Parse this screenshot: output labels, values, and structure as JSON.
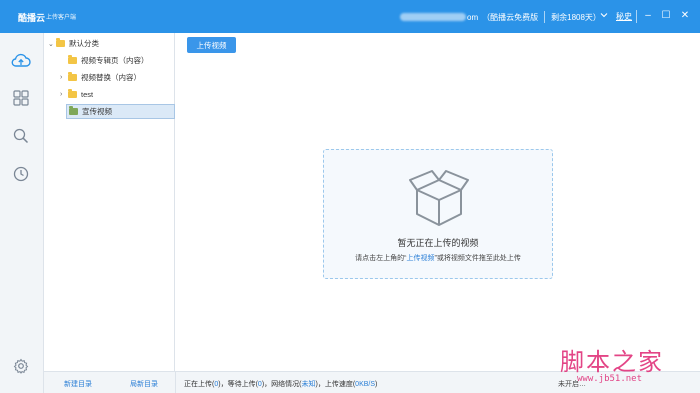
{
  "titlebar": {
    "logo": "酷播云",
    "subtitle": "上传客户端",
    "account_suffix": "om",
    "plan": "（酷播云免费版",
    "remaining": "剩余1808天）",
    "dropdown_icon": "chevron-down-icon",
    "tricks": "秘史",
    "minimize": "–",
    "maximize": "☐",
    "close": "✕"
  },
  "iconnav": {
    "items": [
      "cloud-upload-icon",
      "grid-icon",
      "search-icon",
      "clock-icon",
      "settings-icon"
    ]
  },
  "tree": {
    "root": "默认分类",
    "items": [
      {
        "label": "视频专辑页（内容）"
      },
      {
        "label": "视频替换（内容）"
      },
      {
        "label": "test"
      },
      {
        "label": "宣传视频"
      }
    ]
  },
  "toolbar": {
    "upload_label": "上传视频"
  },
  "dropzone": {
    "title": "暂无正在上传的视频",
    "hint_before": "请点击左上角的“",
    "hint_link": "上传视频",
    "hint_after": "”或将视频文件拖至此处上传"
  },
  "bottom": {
    "new_dir": "新建目录",
    "rename_dir": "局新目录",
    "status_uploading": "正在上传(",
    "uploading_count": "0",
    "status_waiting": ")，等待上传(",
    "waiting_count": "0",
    "status_network": ")，网络情况(",
    "network_value": "未知",
    "status_speed": ")，上传速度(",
    "speed_value": "0KB/S",
    "status_end": ")",
    "right_text": "未开启…"
  },
  "watermark": {
    "main": "脚本之家",
    "sub": "www.jb51.net"
  },
  "colors": {
    "accent": "#2b93e8",
    "link": "#2b7fd6",
    "folder": "#f3c545",
    "watermark": "#e0317a"
  }
}
